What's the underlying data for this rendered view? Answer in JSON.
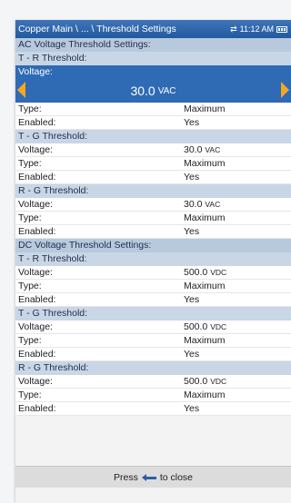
{
  "titlebar": {
    "title": "Copper Main \\ ... \\ Threshold Settings",
    "time": "11:12 AM",
    "sync_icon": "sync-icon",
    "battery_icon": "battery-icon"
  },
  "ac": {
    "header": "AC Voltage Threshold Settings:",
    "tr": {
      "header": "T - R Threshold:",
      "voltage_label": "Voltage:",
      "voltage_value": "30.0",
      "voltage_unit": "VAC",
      "type_label": "Type:",
      "type_value": "Maximum",
      "enabled_label": "Enabled:",
      "enabled_value": "Yes"
    },
    "tg": {
      "header": "T - G Threshold:",
      "voltage_label": "Voltage:",
      "voltage_value": "30.0",
      "voltage_unit": "VAC",
      "type_label": "Type:",
      "type_value": "Maximum",
      "enabled_label": "Enabled:",
      "enabled_value": "Yes"
    },
    "rg": {
      "header": "R - G Threshold:",
      "voltage_label": "Voltage:",
      "voltage_value": "30.0",
      "voltage_unit": "VAC",
      "type_label": "Type:",
      "type_value": "Maximum",
      "enabled_label": "Enabled:",
      "enabled_value": "Yes"
    }
  },
  "dc": {
    "header": "DC Voltage Threshold Settings:",
    "tr": {
      "header": "T - R Threshold:",
      "voltage_label": "Voltage:",
      "voltage_value": "500.0",
      "voltage_unit": "VDC",
      "type_label": "Type:",
      "type_value": "Maximum",
      "enabled_label": "Enabled:",
      "enabled_value": "Yes"
    },
    "tg": {
      "header": "T - G Threshold:",
      "voltage_label": "Voltage:",
      "voltage_value": "500.0",
      "voltage_unit": "VDC",
      "type_label": "Type:",
      "type_value": "Maximum",
      "enabled_label": "Enabled:",
      "enabled_value": "Yes"
    },
    "rg": {
      "header": "R - G Threshold:",
      "voltage_label": "Voltage:",
      "voltage_value": "500.0",
      "voltage_unit": "VDC",
      "type_label": "Type:",
      "type_value": "Maximum",
      "enabled_label": "Enabled:",
      "enabled_value": "Yes"
    }
  },
  "footer": {
    "press_label": "Press",
    "close_label": "to close",
    "enter_icon": "enter-key-icon"
  },
  "colors": {
    "titlebar": "#225a9f",
    "selected": "#2f6ab5",
    "section_header": "#b8c9de",
    "arrow": "#f5a623"
  }
}
